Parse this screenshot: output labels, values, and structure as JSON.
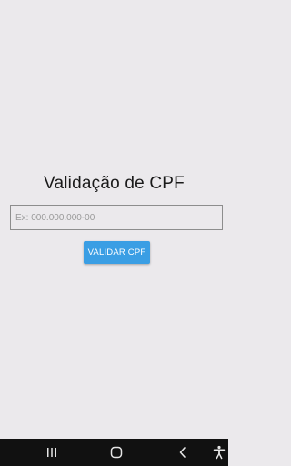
{
  "app": {
    "title": "Validação de CPF"
  },
  "cpf_input": {
    "value": "",
    "placeholder": "Ex: 000.000.000-00"
  },
  "validate_button": {
    "label": "VALIDAR CPF"
  },
  "colors": {
    "background": "#ebe9ec",
    "accent": "#3a9ee4",
    "navbar": "#111111"
  },
  "navbar": {
    "icons": [
      "recent-apps-icon",
      "home-icon",
      "back-icon",
      "accessibility-icon"
    ]
  }
}
